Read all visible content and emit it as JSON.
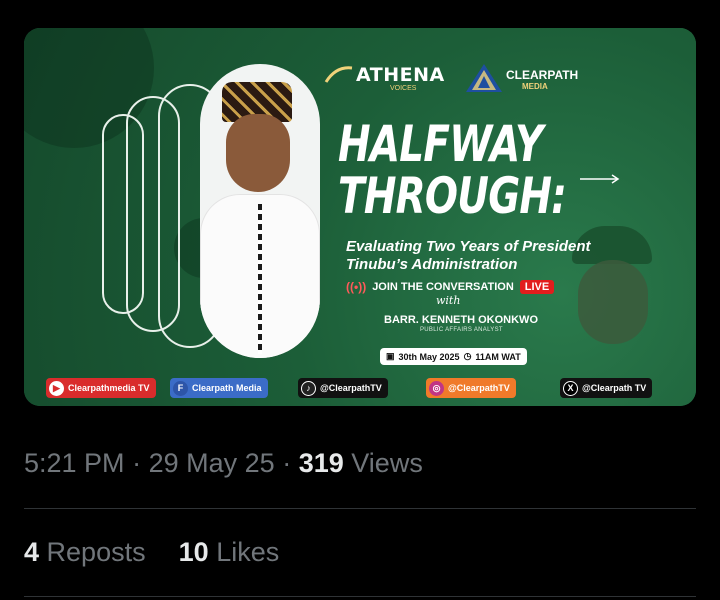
{
  "flyer": {
    "logo_athena": "ATHENA",
    "logo_athena_sub": "VOICES",
    "logo_clearpath": "CLEARPATH",
    "logo_clearpath_sub": "MEDIA",
    "headline_line1": "HALFWAY",
    "headline_line2": "THROUGH:",
    "subtitle_line1": "Evaluating Two Years of President",
    "subtitle_line2": "Tinubu’s Administration",
    "join_text": "JOIN THE CONVERSATION",
    "live_badge": "LIVE",
    "with_text": "with",
    "guest_name": "BARR. KENNETH OKONKWO",
    "guest_role": "PUBLIC AFFAIRS ANALYST",
    "date": "30th May 2025",
    "time": "11AM WAT",
    "socials": {
      "youtube": "Clearpathmedia TV",
      "facebook": "Clearpath Media",
      "tiktok": "@ClearpathTV",
      "instagram": "@ClearpathTV",
      "x": "@Clearpath TV"
    },
    "colors": {
      "background_green": "#1f6a40",
      "live_red": "#e21d1d",
      "accent_gold": "#f0d27a"
    }
  },
  "post": {
    "time": "5:21 PM",
    "separator": "·",
    "date": "29 May 25",
    "views_count": "319",
    "views_label": "Views",
    "reposts_count": "4",
    "reposts_label": "Reposts",
    "likes_count": "10",
    "likes_label": "Likes"
  }
}
